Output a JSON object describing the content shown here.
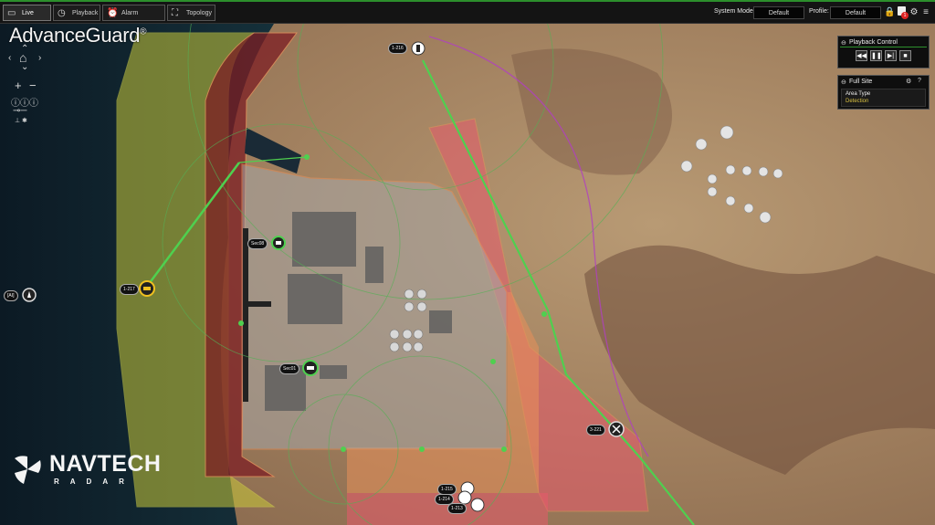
{
  "tabs": [
    {
      "label": "Live",
      "icon": "monitor-icon"
    },
    {
      "label": "Playback",
      "icon": "clock-icon"
    },
    {
      "label": "Alarm Dashboard",
      "icon": "alarm-clock-icon"
    },
    {
      "label": "Topology",
      "icon": "topology-icon"
    }
  ],
  "header": {
    "system_mode_label": "System Mode:",
    "system_mode_value": "Default",
    "profile_label": "Profile:",
    "profile_value": "Default",
    "notification_count": "1"
  },
  "brand": {
    "name": "AdvanceGuard",
    "mark": "®"
  },
  "playback_control": {
    "title": "Playback Control"
  },
  "site_panel": {
    "title": "Full Site",
    "column_label": "Area Type",
    "row_value": "Detection"
  },
  "map_labels": {
    "cam_top": "1-216",
    "cam_left": "1-217",
    "sector_upper": "Sec08",
    "sector_lower": "Sec01",
    "ais": "[AI]",
    "cam_right": "3-221",
    "tracks": [
      "1-215",
      "1-214",
      "1-213"
    ]
  },
  "logo": {
    "line1": "NAVTECH",
    "line2": "RADAR"
  },
  "colors": {
    "accent_green": "#2c8f2c",
    "zone_yellow": "#c8c83a",
    "zone_red": "#7d1e24",
    "zone_pink": "#e85a6c",
    "zone_orange": "#e8905a",
    "track_green": "#4fd04f"
  }
}
